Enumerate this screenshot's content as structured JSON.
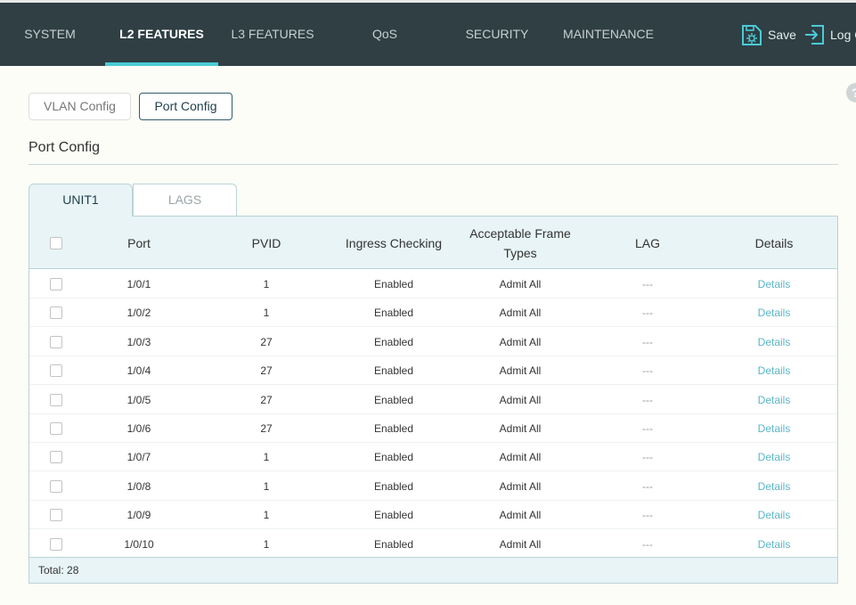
{
  "nav": {
    "items": [
      {
        "label": "SYSTEM",
        "active": false
      },
      {
        "label": "L2 FEATURES",
        "active": true
      },
      {
        "label": "L3 FEATURES",
        "active": false
      },
      {
        "label": "QoS",
        "active": false
      },
      {
        "label": "SECURITY",
        "active": false
      },
      {
        "label": "MAINTENANCE",
        "active": false
      }
    ],
    "save_label": "Save",
    "logout_label": "Log Out",
    "accent": "#4acbd6"
  },
  "subtabs": {
    "vlan_config": "VLAN Config",
    "port_config": "Port Config"
  },
  "section_title": "Port Config",
  "unit_tabs": {
    "unit1": "UNIT1",
    "lags": "LAGS"
  },
  "table": {
    "headers": {
      "port": "Port",
      "pvid": "PVID",
      "ingress": "Ingress Checking",
      "frame_types_1": "Acceptable Frame",
      "frame_types_2": "Types",
      "lag": "LAG",
      "details": "Details"
    },
    "rows": [
      {
        "port": "1/0/1",
        "pvid": "1",
        "ingress": "Enabled",
        "frame": "Admit All",
        "lag": "---",
        "details": "Details"
      },
      {
        "port": "1/0/2",
        "pvid": "1",
        "ingress": "Enabled",
        "frame": "Admit All",
        "lag": "---",
        "details": "Details"
      },
      {
        "port": "1/0/3",
        "pvid": "27",
        "ingress": "Enabled",
        "frame": "Admit All",
        "lag": "---",
        "details": "Details"
      },
      {
        "port": "1/0/4",
        "pvid": "27",
        "ingress": "Enabled",
        "frame": "Admit All",
        "lag": "---",
        "details": "Details"
      },
      {
        "port": "1/0/5",
        "pvid": "27",
        "ingress": "Enabled",
        "frame": "Admit All",
        "lag": "---",
        "details": "Details"
      },
      {
        "port": "1/0/6",
        "pvid": "27",
        "ingress": "Enabled",
        "frame": "Admit All",
        "lag": "---",
        "details": "Details"
      },
      {
        "port": "1/0/7",
        "pvid": "1",
        "ingress": "Enabled",
        "frame": "Admit All",
        "lag": "---",
        "details": "Details"
      },
      {
        "port": "1/0/8",
        "pvid": "1",
        "ingress": "Enabled",
        "frame": "Admit All",
        "lag": "---",
        "details": "Details"
      },
      {
        "port": "1/0/9",
        "pvid": "1",
        "ingress": "Enabled",
        "frame": "Admit All",
        "lag": "---",
        "details": "Details"
      },
      {
        "port": "1/0/10",
        "pvid": "1",
        "ingress": "Enabled",
        "frame": "Admit All",
        "lag": "---",
        "details": "Details"
      }
    ],
    "total": "Total: 28"
  }
}
